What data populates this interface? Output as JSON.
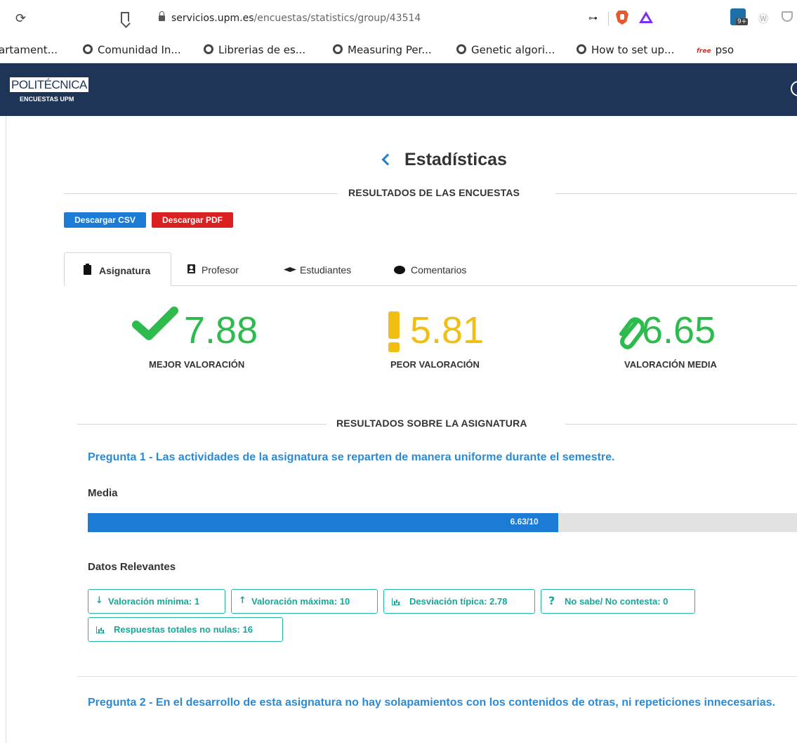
{
  "browser": {
    "url_host": "servicios.upm.es",
    "url_path": "/encuestas/statistics/group/43514",
    "extension_badge": "9+"
  },
  "bookmarks": [
    {
      "label": "artament..."
    },
    {
      "label": "Comunidad In..."
    },
    {
      "label": "Librerias de es..."
    },
    {
      "label": "Measuring Per..."
    },
    {
      "label": "Genetic algori..."
    },
    {
      "label": "How to set up..."
    },
    {
      "label": "pso",
      "icon_text": "free"
    }
  ],
  "header": {
    "logo_main": "POLITÉCNICA",
    "logo_sub": "ENCUESTAS UPM",
    "brand_color": "#1e3558"
  },
  "page": {
    "title": "Estadísticas",
    "section_title": "RESULTADOS DE LAS ENCUESTAS",
    "buttons": {
      "csv": "Descargar CSV",
      "pdf": "Descargar PDF"
    },
    "tabs": [
      {
        "label": "Asignatura",
        "icon": "clipboard-icon",
        "active": true
      },
      {
        "label": "Profesor",
        "icon": "contact-card-icon",
        "active": false
      },
      {
        "label": "Estudiantes",
        "icon": "graduation-cap-icon",
        "active": false
      },
      {
        "label": "Comentarios",
        "icon": "comment-icon",
        "active": false
      }
    ],
    "metrics": {
      "best": {
        "value": "7.88",
        "label": "MEJOR VALORACIÓN",
        "icon": "check-icon",
        "color": "#2dbb4e"
      },
      "worst": {
        "value": "5.81",
        "label": "PEOR VALORACIÓN",
        "icon": "exclamation-icon",
        "color": "#f3be14"
      },
      "average": {
        "value": "6.65",
        "label": "VALORACIÓN MEDIA",
        "icon": "paperclip-icon",
        "color": "#2dbb4e"
      }
    },
    "results_section_title": "RESULTADOS SOBRE LA ASIGNATURA",
    "questions": [
      {
        "title": "Pregunta 1 - Las actividades de la asignatura se reparten de manera uniforme durante el semestre.",
        "media_label": "Media",
        "mean": 6.63,
        "max": 10,
        "mean_text": "6.63/10",
        "datos_label": "Datos Relevantes",
        "stats": {
          "min": "Valoración mínima: 1",
          "max": "Valoración máxima: 10",
          "std": "Desviación típica: 2.78",
          "nsnc": "No sabe/ No contesta: 0",
          "total": "Respuestas totales no nulas: 16"
        }
      },
      {
        "title": "Pregunta 2 - En el desarrollo de esta asignatura no hay solapamientos con los contenidos de otras, ni repeticiones innecesarias."
      }
    ]
  }
}
